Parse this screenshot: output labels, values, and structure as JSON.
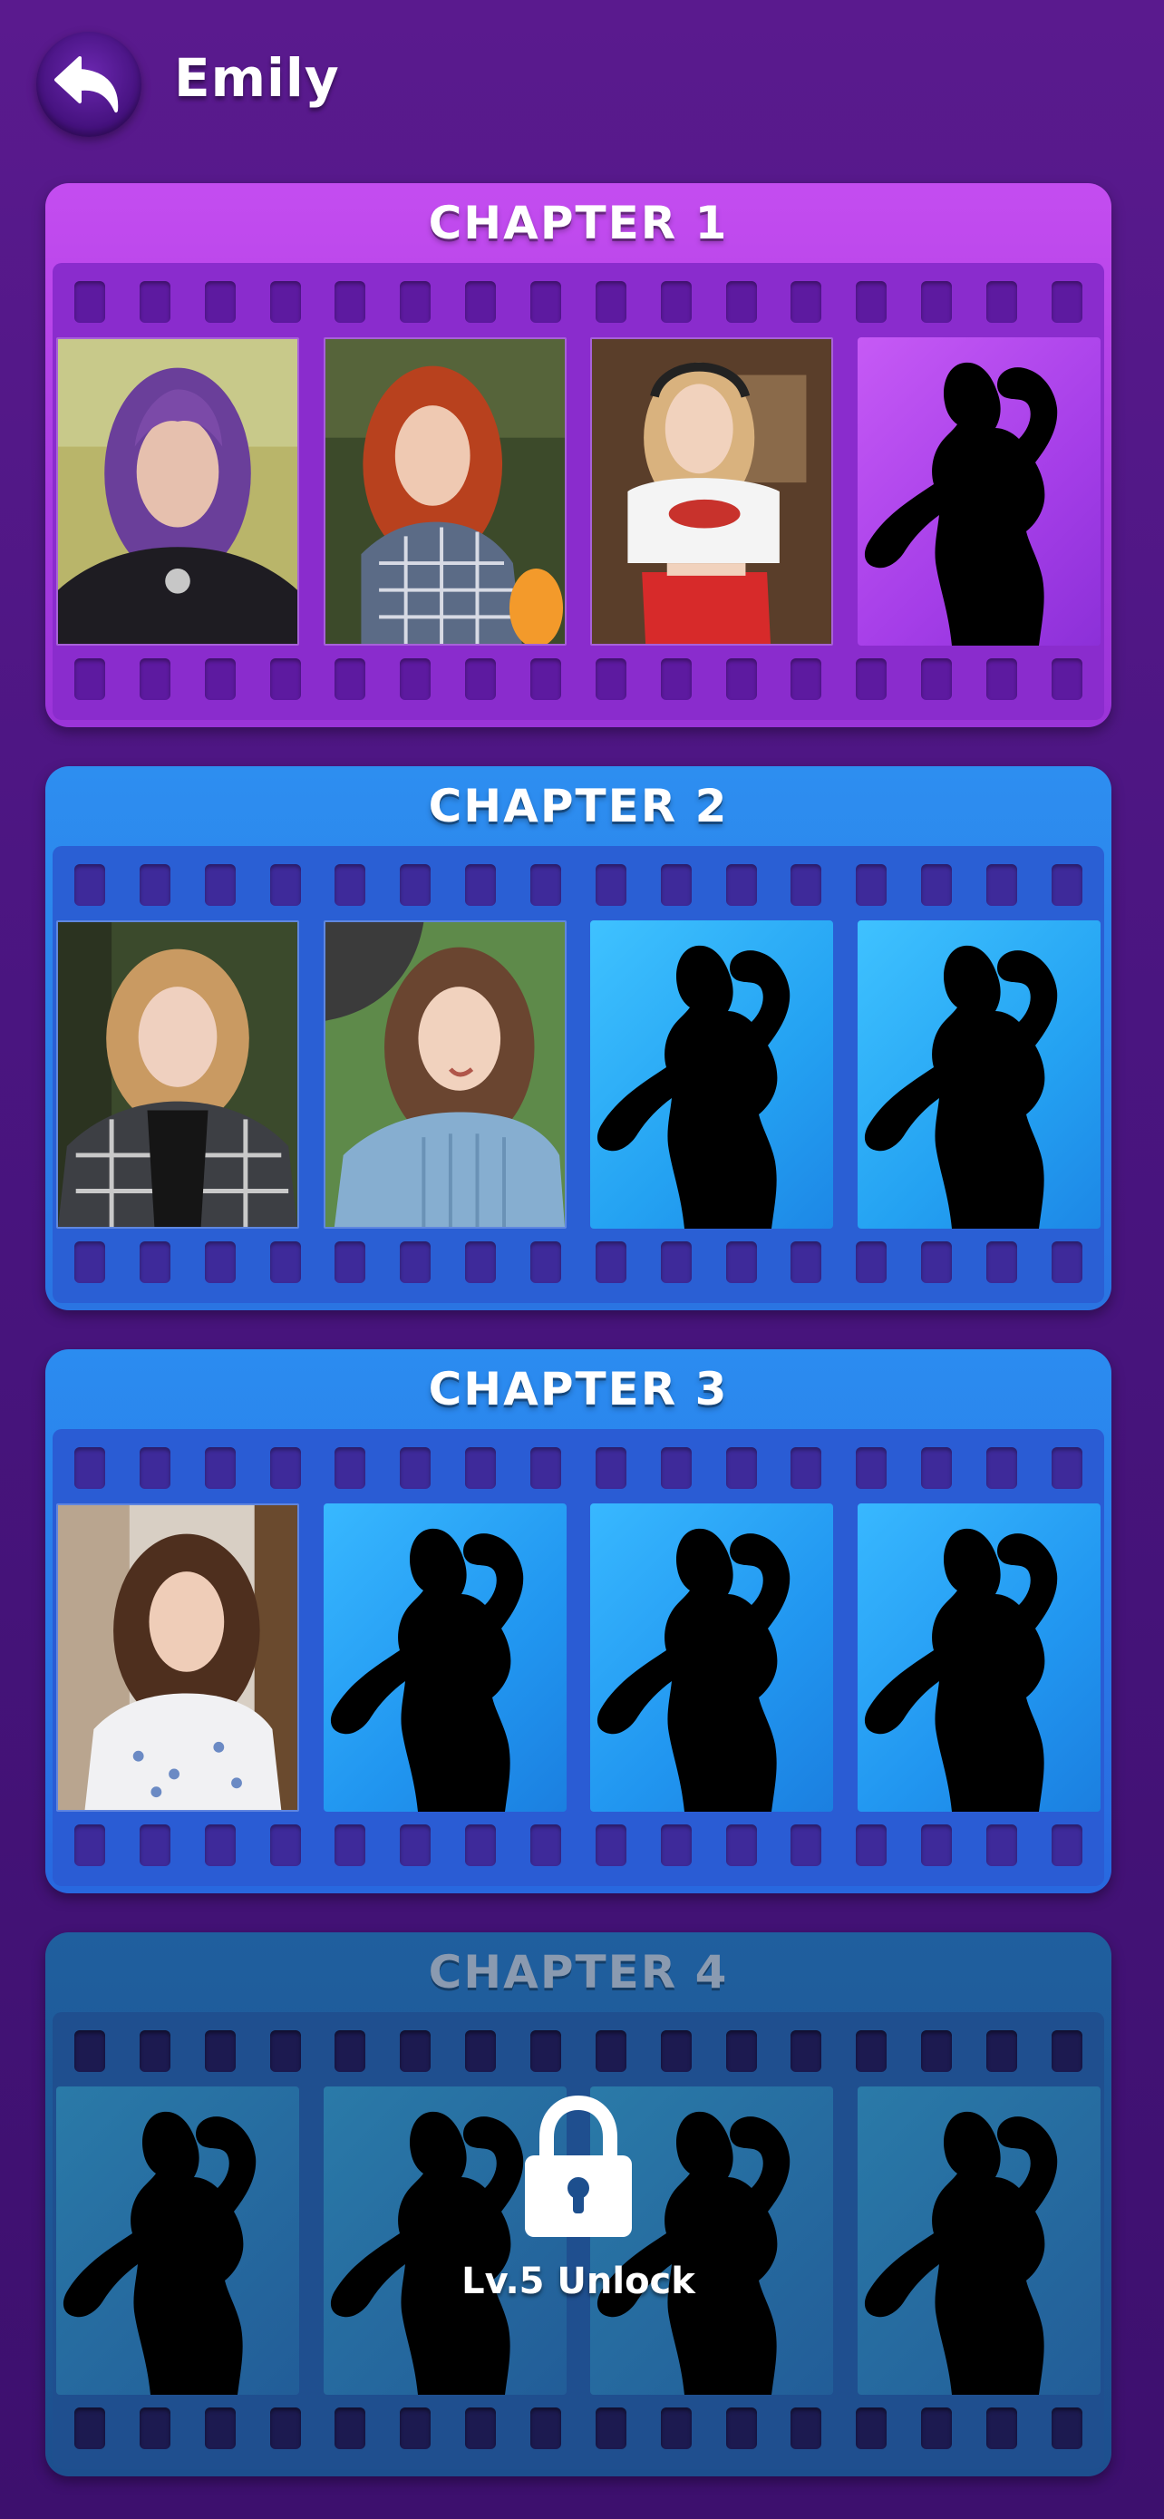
{
  "header": {
    "title": "Emily",
    "back_icon": "back-arrow-icon"
  },
  "chapters": [
    {
      "title": "CHAPTER 1",
      "locked": false,
      "frames": [
        "photo-purple-hair",
        "photo-red-hair",
        "photo-blonde-headphones",
        "silhouette"
      ]
    },
    {
      "title": "CHAPTER 2",
      "locked": false,
      "frames": [
        "photo-plaid-blonde",
        "photo-blue-sweater",
        "silhouette",
        "silhouette"
      ]
    },
    {
      "title": "CHAPTER 3",
      "locked": false,
      "frames": [
        "photo-brown-hair-window",
        "silhouette",
        "silhouette",
        "silhouette"
      ]
    },
    {
      "title": "CHAPTER 4",
      "locked": true,
      "unlock_text": "Lv.5 Unlock",
      "frames": [
        "silhouette",
        "silhouette",
        "silhouette",
        "silhouette"
      ]
    }
  ],
  "colors": {
    "background": "#4a1580",
    "chapter1": "#a73ae0",
    "chapter2": "#2a74e2",
    "chapter3": "#2868df",
    "chapter4_locked": "#1d4f8e"
  }
}
